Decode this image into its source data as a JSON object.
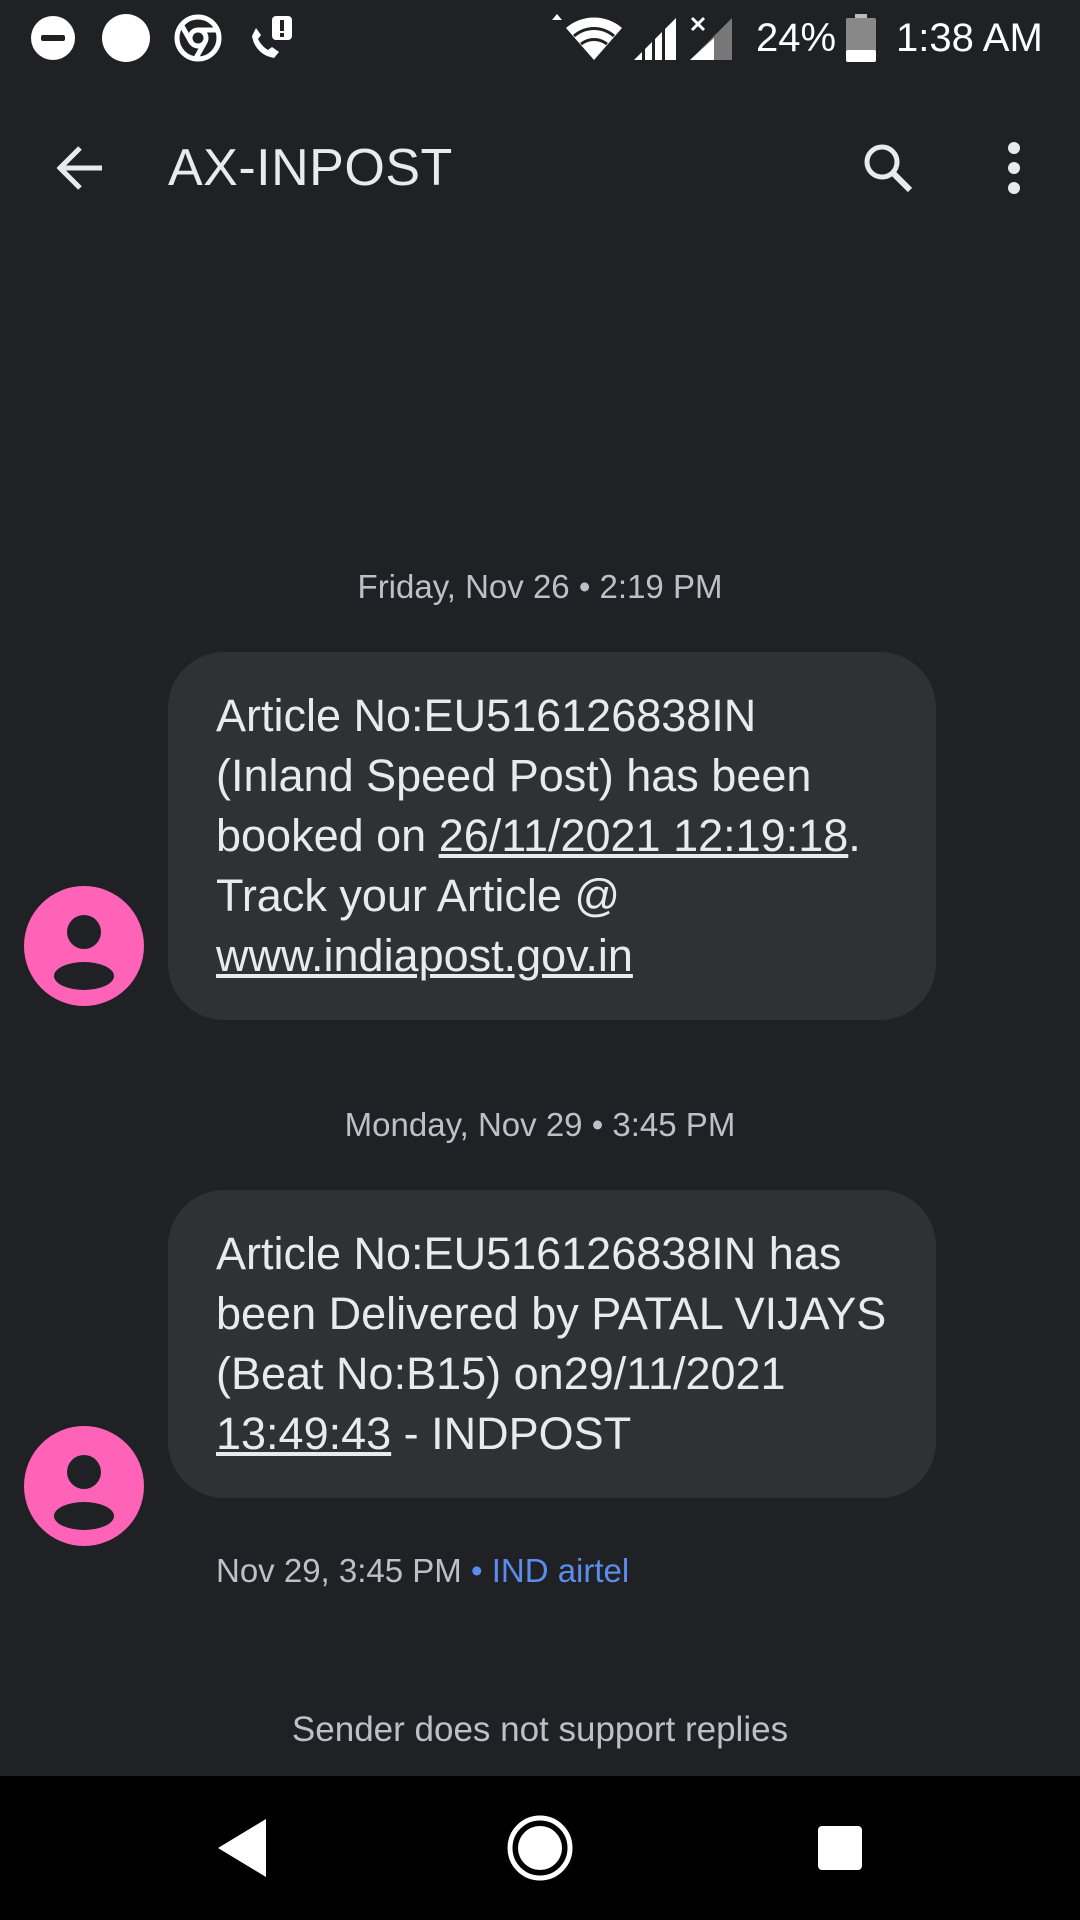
{
  "status_bar": {
    "battery_percent": "24%",
    "time": "1:38 AM",
    "icons": [
      "do-not-disturb-icon",
      "circle-icon",
      "chrome-icon",
      "call-alert-icon",
      "wifi-icon",
      "cell-signal-icon",
      "cell-signal-no-service-icon",
      "battery-icon"
    ]
  },
  "app_bar": {
    "title": "AX-INPOST"
  },
  "messages": [
    {
      "date": "Friday, Nov 26 • 2:19 PM",
      "parts": [
        {
          "text": "Article No:EU516126838IN (Inland Speed Post) has been booked on "
        },
        {
          "text": "26/11/2021 12:19:18",
          "link": true
        },
        {
          "text": ". Track your Article @ "
        },
        {
          "text": "www.indiapost.gov.in",
          "link": true
        }
      ]
    },
    {
      "date": "Monday, Nov 29 • 3:45 PM",
      "parts": [
        {
          "text": "Article No:EU516126838IN has been Delivered by PATAL VIJAYS (Beat No:B15) on29/11/2021 "
        },
        {
          "text": "13:49:43",
          "link": true
        },
        {
          "text": " - INDPOST"
        }
      ],
      "meta": {
        "time": "Nov 29, 3:45 PM",
        "carrier": "• IND airtel"
      }
    }
  ],
  "footer": {
    "no_reply_text": "Sender does not support replies"
  },
  "colors": {
    "background": "#202124",
    "bubble": "#303134",
    "avatar": "#ff63b8",
    "carrier": "#5b8def"
  }
}
